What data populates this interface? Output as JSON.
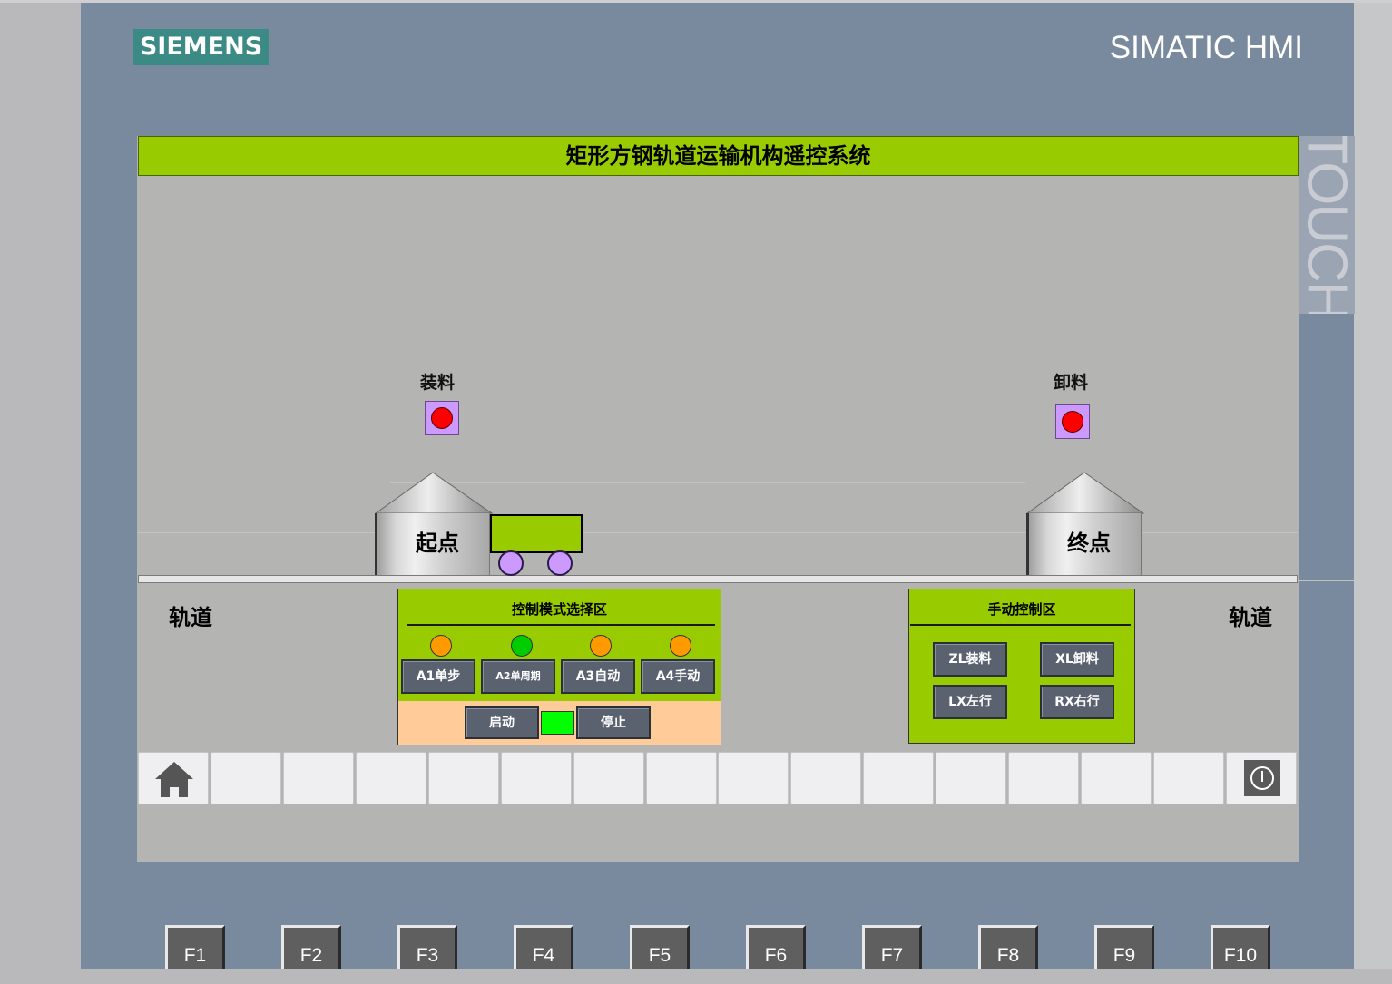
{
  "device": {
    "brand_logo": "SIEMENS",
    "model_label": "SIMATIC HMI",
    "touch_label": "TOUCH"
  },
  "screen": {
    "title": "矩形方钢轨道运输机构遥控系统",
    "load_lamp": {
      "label": "装料",
      "state": "off",
      "color": "#ff0000"
    },
    "unload_lamp": {
      "label": "卸料",
      "state": "off",
      "color": "#ff0000"
    },
    "start_silo": {
      "label": "起点"
    },
    "end_silo": {
      "label": "终点"
    },
    "track_left_label": "轨道",
    "track_right_label": "轨道"
  },
  "mode_panel": {
    "title": "控制模式选择区",
    "modes": [
      {
        "label": "A1单步",
        "indicator_color": "#ff9900"
      },
      {
        "label": "A2单周期",
        "indicator_color": "#00cc00"
      },
      {
        "label": "A3自动",
        "indicator_color": "#ff9900"
      },
      {
        "label": "A4手动",
        "indicator_color": "#ff9900"
      }
    ],
    "start_label": "启动",
    "stop_label": "停止",
    "run_indicator_color": "#00ff00"
  },
  "manual_panel": {
    "title": "手动控制区",
    "buttons": [
      {
        "label": "ZL装料"
      },
      {
        "label": "XL卸料"
      },
      {
        "label": "LX左行"
      },
      {
        "label": "RX右行"
      }
    ]
  },
  "softkeys": {
    "home_icon": "home-icon",
    "power_icon": "power-icon"
  },
  "function_keys": [
    "F1",
    "F2",
    "F3",
    "F4",
    "F5",
    "F6",
    "F7",
    "F8",
    "F9",
    "F10"
  ],
  "colors": {
    "accent_green": "#99cc00",
    "lamp_frame": "#cc99ff",
    "bezel": "#7a8a9e"
  }
}
